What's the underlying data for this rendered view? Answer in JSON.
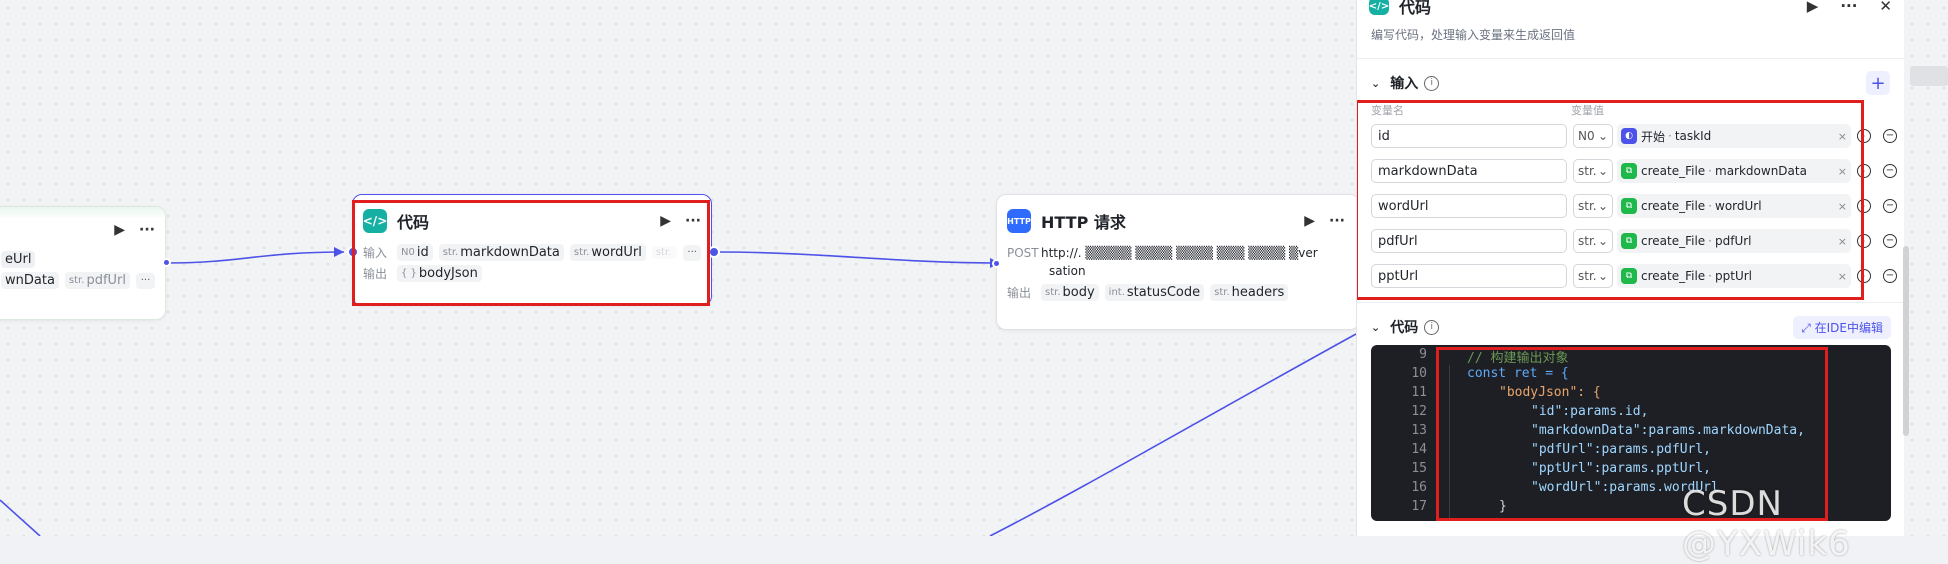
{
  "left_node": {
    "row1_tag": "eUrl",
    "row2_tag1": "wnData",
    "row2_tag2_type": "str.",
    "row2_tag2": "pdfUrl",
    "more": "···"
  },
  "code_node": {
    "title": "代码",
    "input_label": "输入",
    "output_label": "输出",
    "inputs": [
      {
        "type": "N0",
        "name": "id"
      },
      {
        "type": "str.",
        "name": "markdownData"
      },
      {
        "type": "str.",
        "name": "wordUrl"
      },
      {
        "type": "str.",
        "name": ""
      }
    ],
    "outputs": [
      {
        "type": "{ }",
        "name": "bodyJson"
      }
    ],
    "more": "···"
  },
  "http_node": {
    "title": "HTTP 请求",
    "icon_text": "HTTP",
    "method": "POST",
    "url_line1": "http://.  ▒▒▒▒▒ ▒▒▒▒  ▒▒▒▒ ▒▒▒ ▒▒▒▒ ▒ver",
    "url_line2": "sation",
    "output_label": "输出",
    "outputs": [
      {
        "type": "str.",
        "name": "body"
      },
      {
        "type": "int.",
        "name": "statusCode"
      },
      {
        "type": "str.",
        "name": "headers"
      }
    ]
  },
  "panel": {
    "title": "代码",
    "description": "编写代码，处理输入变量来生成返回值",
    "input_section": "输入",
    "col_var_name": "变量名",
    "col_var_value": "变量值",
    "variables": [
      {
        "name": "id",
        "type": "N0",
        "node": "开始",
        "field": "taskId",
        "color": "#4d53e8"
      },
      {
        "name": "markdownData",
        "type": "str.",
        "node": "create_File",
        "field": "markdownData",
        "color": "#1fb84a"
      },
      {
        "name": "wordUrl",
        "type": "str.",
        "node": "create_File",
        "field": "wordUrl",
        "color": "#1fb84a"
      },
      {
        "name": "pdfUrl",
        "type": "str.",
        "node": "create_File",
        "field": "pdfUrl",
        "color": "#1fb84a"
      },
      {
        "name": "pptUrl",
        "type": "str.",
        "node": "create_File",
        "field": "pptUrl",
        "color": "#1fb84a"
      }
    ],
    "code_section": "代码",
    "ide_button": "在IDE中编辑",
    "code_lines": [
      {
        "n": "9",
        "text": "// 构建输出对象"
      },
      {
        "n": "10",
        "text": "const ret = {"
      },
      {
        "n": "11",
        "text": "\"bodyJson\": {"
      },
      {
        "n": "12",
        "text": "\"id\":params.id,"
      },
      {
        "n": "13",
        "text": "\"markdownData\":params.markdownData,"
      },
      {
        "n": "14",
        "text": "\"pdfUrl\":params.pdfUrl,"
      },
      {
        "n": "15",
        "text": "\"pptUrl\":params.pptUrl,"
      },
      {
        "n": "16",
        "text": "\"wordUrl\":params.wordUrl"
      },
      {
        "n": "17",
        "text": "}"
      }
    ]
  },
  "watermark": "CSDN @YXWik6",
  "colors": {
    "accent": "#4d53e8",
    "highlight": "#e01e1e",
    "code_bg": "#1e1f24"
  }
}
